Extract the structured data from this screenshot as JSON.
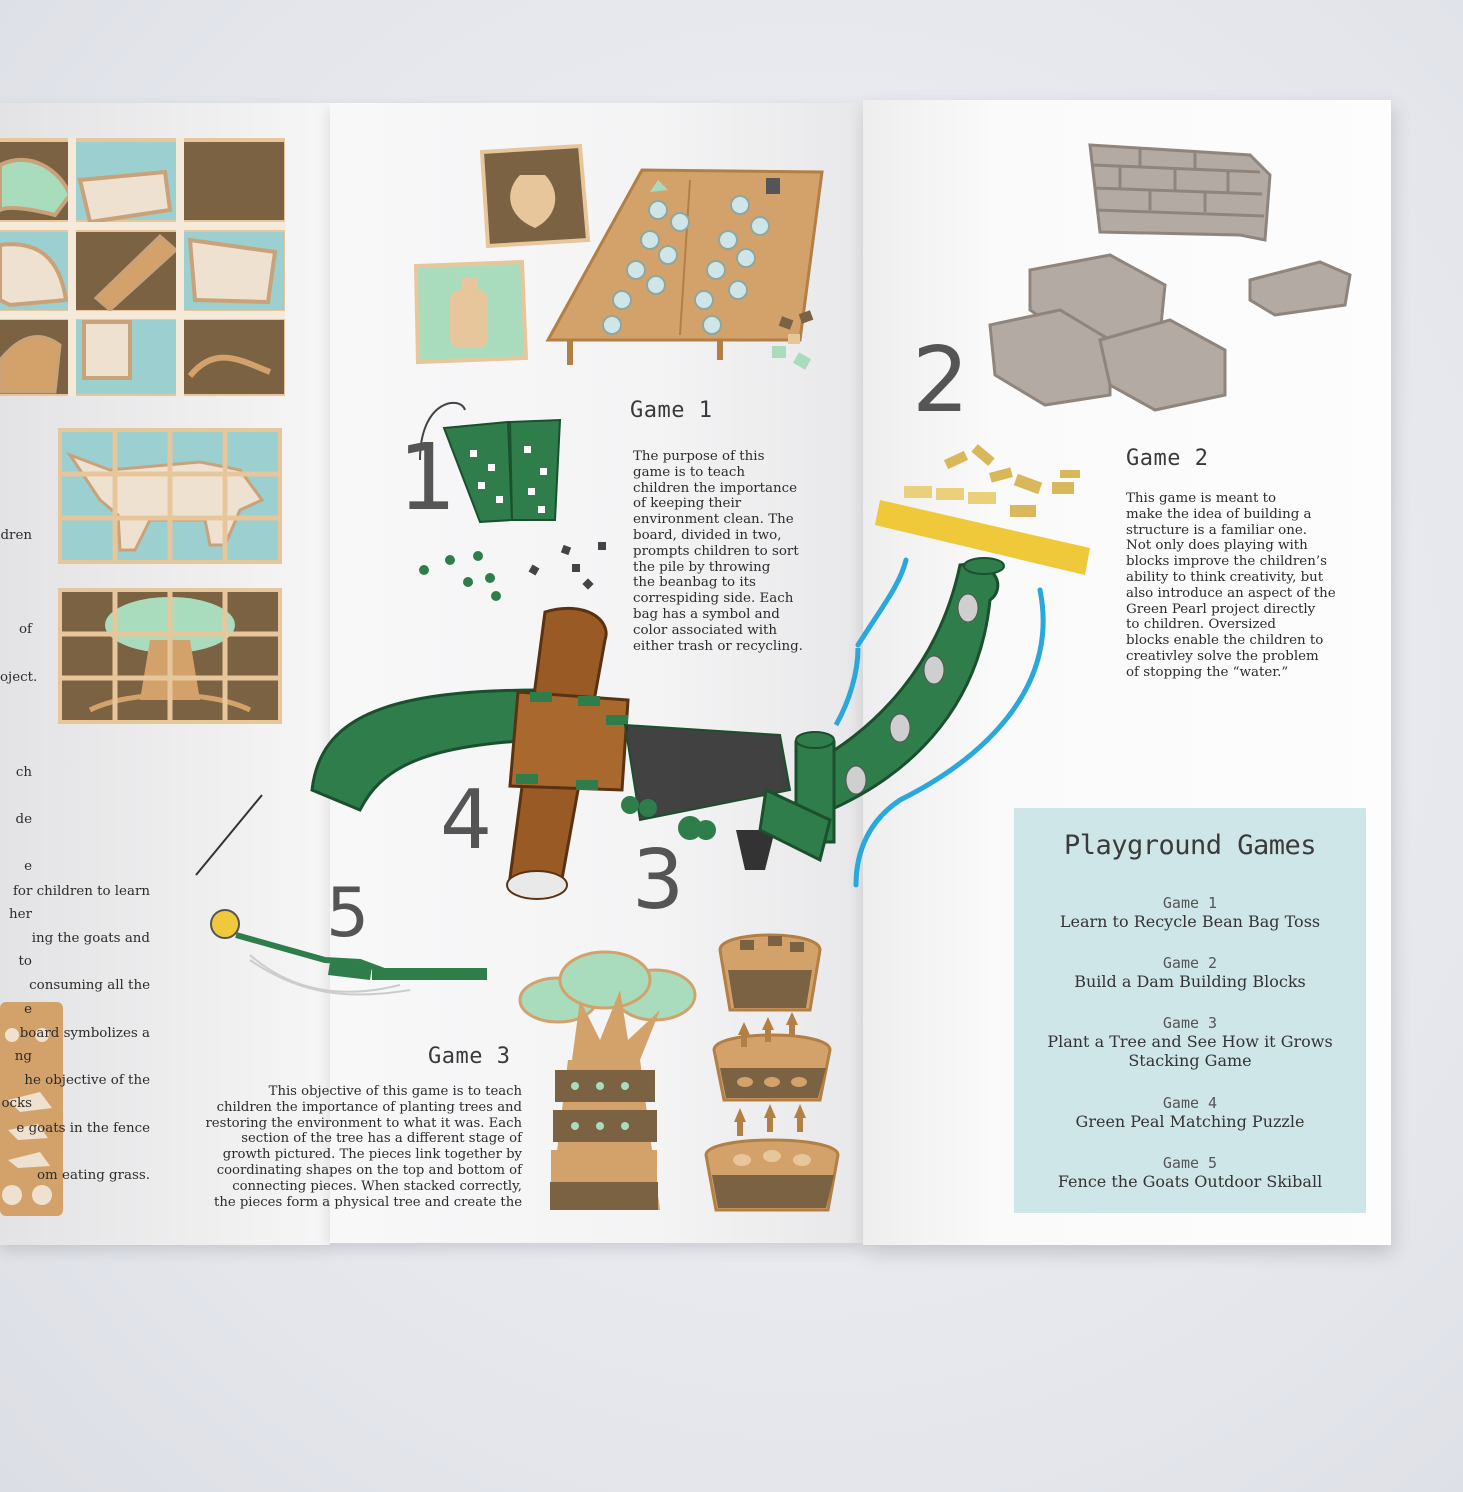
{
  "game1": {
    "heading": "Game 1",
    "body": "The purpose of this\ngame is to teach\nchildren the importance\nof keeping their\nenvironment clean. The\nboard, divided in two,\nprompts children to sort\nthe pile by throwing\nthe beanbag to its\ncorrespiding side. Each\nbag has a symbol and\ncolor associated with\neither trash or recycling."
  },
  "game2": {
    "heading": "Game 2",
    "body": "This game is meant to\nmake the idea of building a\nstructure is a familiar one.\nNot only does playing with\nblocks improve the children’s\nability to think creativity, but\nalso introduce an aspect of the\nGreen Pearl project directly\nto children. Oversized\nblocks enable the children to\ncreativley solve the problem\nof stopping the “water.”"
  },
  "game3": {
    "heading": "Game 3",
    "body": "This objective of this game is to teach\nchildren the importance of planting trees and\nrestoring the environment to what it was. Each\nsection of the tree has a different stage of\ngrowth pictured. The pieces link together by\ncoordinating shapes on the top and bottom of\nconnecting pieces. When stacked correctly,\nthe pieces form a physical tree and create the"
  },
  "left_panel": {
    "fragment_a": [
      "dren",
      "",
      "of",
      "oject.",
      "",
      "ch",
      "de",
      "e",
      "her",
      "to",
      "e",
      "ng",
      "ocks"
    ],
    "fragment_b": [
      "for children to learn",
      "ing the goats and",
      "consuming all the",
      "board symbolizes a",
      "he objective of the",
      "e goats in the fence",
      "om eating grass."
    ]
  },
  "diagram_numbers": [
    "1",
    "2",
    "3",
    "4",
    "5"
  ],
  "toc": {
    "title": "Playground Games",
    "games": [
      {
        "num": "Game 1",
        "name": "Learn to Recycle Bean Bag Toss"
      },
      {
        "num": "Game 2",
        "name": "Build a Dam Building Blocks"
      },
      {
        "num": "Game 3",
        "name": "Plant a Tree and See How it Grows\nStacking Game"
      },
      {
        "num": "Game 4",
        "name": "Green Peal Matching Puzzle"
      },
      {
        "num": "Game 5",
        "name": "Fence the Goats Outdoor Skiball"
      }
    ]
  },
  "colors": {
    "green": "#2e7d4a",
    "tan": "#d3a26b",
    "brown": "#7a6243",
    "teal_tile": "#9ccfd0",
    "mint": "#a9dcbc",
    "grey_block": "#b3aaa3",
    "yellow": "#f0c93a",
    "water_blue": "#2aa7db",
    "toc_bg": "#cfe6e8"
  }
}
